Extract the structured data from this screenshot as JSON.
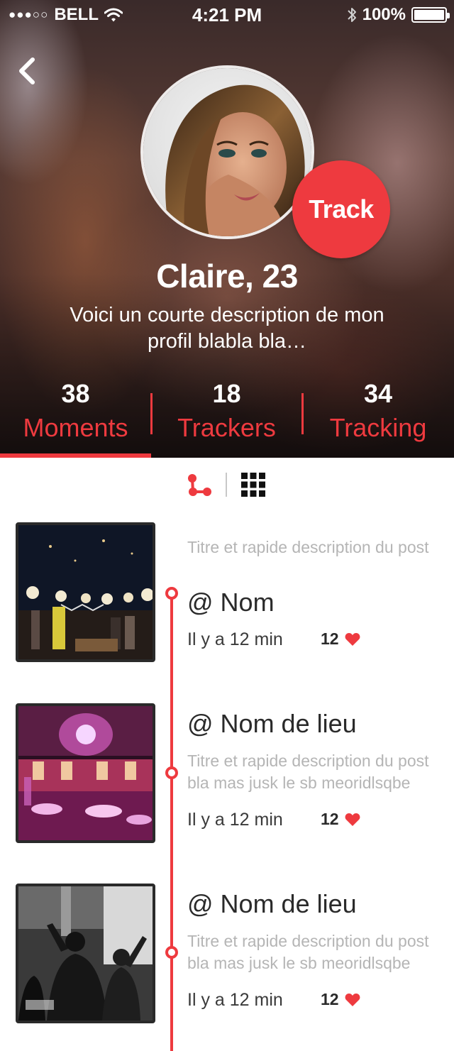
{
  "status_bar": {
    "signal": "●●●○○",
    "carrier": "BELL",
    "time": "4:21 PM",
    "battery": "100%",
    "battery_level": 1.0
  },
  "profile": {
    "name": "Claire, 23",
    "description": "Voici un courte description de mon profil blabla bla…",
    "track_label": "Track"
  },
  "stats": [
    {
      "count": "38",
      "label": "Moments",
      "active": true
    },
    {
      "count": "18",
      "label": "Trackers",
      "active": false
    },
    {
      "count": "34",
      "label": "Tracking",
      "active": false
    }
  ],
  "view_toggle": {
    "active": "timeline"
  },
  "posts": [
    {
      "description": "Titre et rapide description du post",
      "title": "@ Nom",
      "time": "Il y a 12 min",
      "likes": "12"
    },
    {
      "title": "@ Nom de lieu",
      "description": "Titre et rapide description du post bla mas jusk le sb meoridlsqbe",
      "time": "Il y a 12 min",
      "likes": "12"
    },
    {
      "title": "@ Nom de lieu",
      "description": "Titre et rapide description du post bla mas jusk le sb meoridlsqbe",
      "time": "Il y a 12 min",
      "likes": "12"
    }
  ],
  "colors": {
    "accent": "#ee3a3f",
    "text_dark": "#2a2a2a",
    "text_muted": "#b5b5b5"
  }
}
